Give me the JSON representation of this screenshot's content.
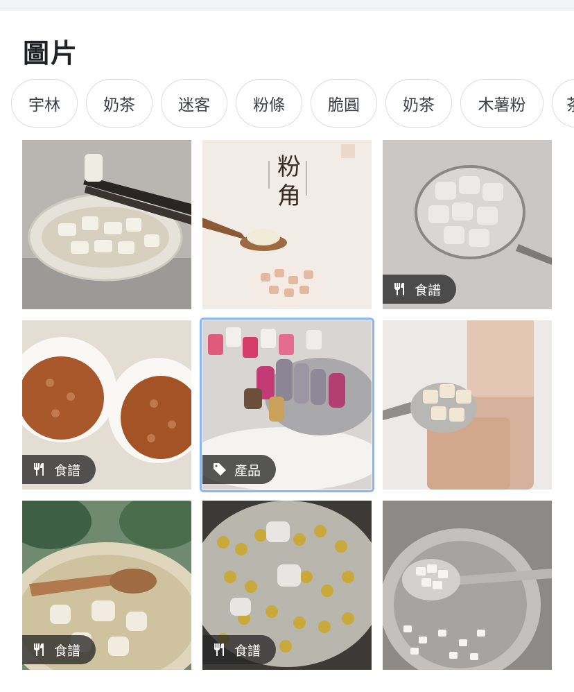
{
  "header": {
    "title": "圖片"
  },
  "chips": [
    {
      "label": "宇林"
    },
    {
      "label": "奶茶"
    },
    {
      "label": "迷客"
    },
    {
      "label": "粉條"
    },
    {
      "label": "脆圓"
    },
    {
      "label": "奶茶"
    },
    {
      "label": "木薯粉"
    },
    {
      "label": "茶"
    }
  ],
  "images": [
    {
      "icon": "",
      "badge": ""
    },
    {
      "icon": "",
      "badge": "",
      "overlay_text": "粉角"
    },
    {
      "icon": "utensils-icon",
      "badge": "食譜"
    },
    {
      "icon": "utensils-icon",
      "badge": "食譜"
    },
    {
      "icon": "tag-icon",
      "badge": "產品",
      "selected": "true"
    },
    {
      "icon": "",
      "badge": ""
    },
    {
      "icon": "utensils-icon",
      "badge": "食譜"
    },
    {
      "icon": "utensils-icon",
      "badge": "食譜"
    },
    {
      "icon": "",
      "badge": ""
    }
  ],
  "colors": {
    "selection": "#8ab4f8",
    "badge_bg": "#282828"
  }
}
